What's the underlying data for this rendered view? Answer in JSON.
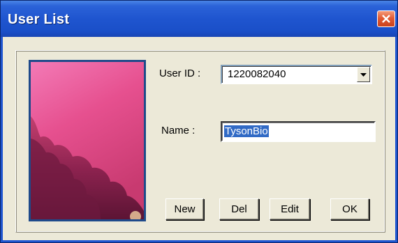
{
  "window": {
    "title": "User List",
    "close_icon": "close-icon"
  },
  "form": {
    "user_id_label": "User ID :",
    "user_id_value": "1220082040",
    "name_label": "Name :",
    "name_value": "TysonBio"
  },
  "picture": {
    "icon": "user-photo"
  },
  "buttons": {
    "new_label": "New",
    "del_label": "Del",
    "edit_label": "Edit",
    "ok_label": "OK"
  },
  "colors": {
    "title_bar": "#1f55cf",
    "selection": "#316ac5",
    "close_button": "#e25c35"
  }
}
